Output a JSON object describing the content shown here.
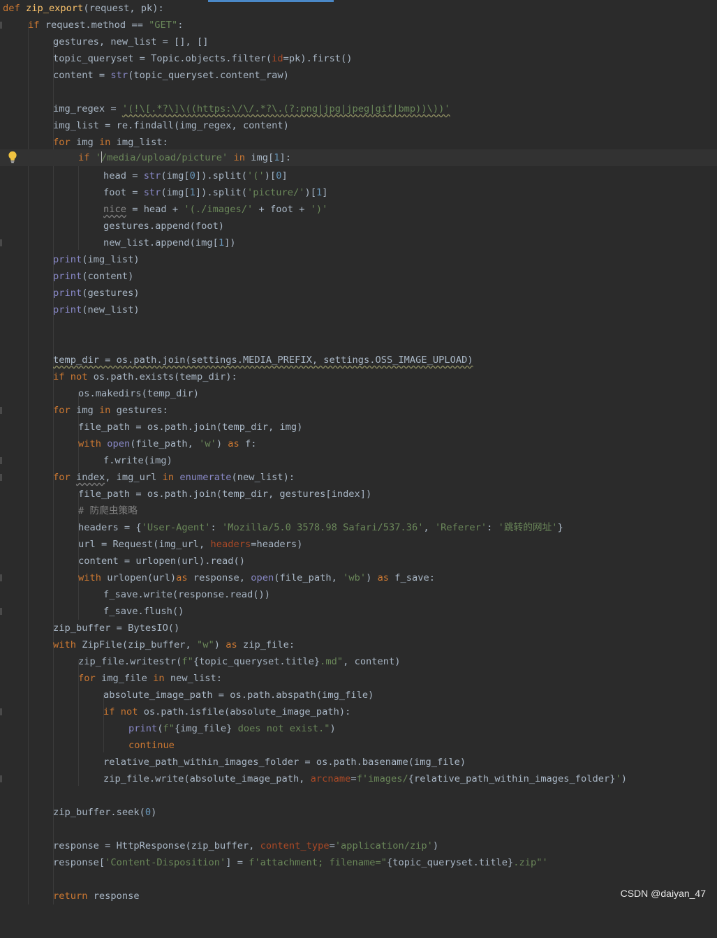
{
  "editor": {
    "lines": {
      "l1_def": "def",
      "l1_name": "zip_export",
      "l1_rest": "(request, pk):",
      "l2_if": "if",
      "l2_mid": " request.method == ",
      "l2_str": "\"GET\"",
      "l2_end": ":",
      "l3": "gestures, new_list = [], []",
      "l4_a": "topic_queryset = Topic.objects.filter(",
      "l4_param": "id",
      "l4_b": "=pk).first()",
      "l5_a": "content = ",
      "l5_bi": "str",
      "l5_b": "(topic_queryset.content_raw)",
      "l7_a": "img_regex = ",
      "l7_str": "'(!\\[.*?\\]\\((https:\\/\\/.*?\\.(?:png|jpg|jpeg|gif|bmp))\\))'",
      "l8": "img_list = re.findall(img_regex, content)",
      "l9_for": "for",
      "l9_a": " img ",
      "l9_in": "in",
      "l9_b": " img_list:",
      "l10_if": "if",
      "l10_q": " '",
      "l10_str": "/media/upload/picture'",
      "l10_in": "in",
      "l10_a": " img[",
      "l10_num": "1",
      "l10_b": "]:",
      "l11_a": "head = ",
      "l11_bi": "str",
      "l11_b": "(img[",
      "l11_n0": "0",
      "l11_c": "]).split(",
      "l11_s": "'('",
      "l11_d": ")[",
      "l11_n1": "0",
      "l11_e": "]",
      "l12_a": "foot = ",
      "l12_bi": "str",
      "l12_b": "(img[",
      "l12_n0": "1",
      "l12_c": "]).split(",
      "l12_s": "'picture/'",
      "l12_d": ")[",
      "l12_n1": "1",
      "l12_e": "]",
      "l13_var": "nice",
      "l13_a": " = head + ",
      "l13_s1": "'(./images/'",
      "l13_b": " + foot + ",
      "l13_s2": "')'",
      "l14": "gestures.append(foot)",
      "l15_a": "new_list.append(img[",
      "l15_n": "1",
      "l15_b": "])",
      "l16_bi": "print",
      "l16_a": "(img_list)",
      "l17_bi": "print",
      "l17_a": "(content)",
      "l18_bi": "print",
      "l18_a": "(gestures)",
      "l19_bi": "print",
      "l19_a": "(new_list)",
      "l22": "temp_dir = os.path.join(settings.MEDIA_PREFIX, settings.OSS_IMAGE_UPLOAD)",
      "l23_if": "if not",
      "l23_a": " os.path.exists(temp_dir):",
      "l24": "os.makedirs(temp_dir)",
      "l25_for": "for",
      "l25_a": " img ",
      "l25_in": "in",
      "l25_b": " gestures:",
      "l26": "file_path = os.path.join(temp_dir, img)",
      "l27_with": "with",
      "l27_bi": "open",
      "l27_a": "(file_path, ",
      "l27_s": "'w'",
      "l27_b": ") ",
      "l27_as": "as",
      "l27_c": " f:",
      "l28": "f.write(img)",
      "l29_for": "for",
      "l29_var": "index",
      "l29_a": ", img_url ",
      "l29_in": "in",
      "l29_bi": "enumerate",
      "l29_b": "(new_list):",
      "l30": "file_path = os.path.join(temp_dir, gestures[index])",
      "l31_cmt": "# 防爬虫策略",
      "l32_a": "headers = {",
      "l32_s1": "'User-Agent'",
      "l32_b": ": ",
      "l32_s2": "'Mozilla/5.0 3578.98 Safari/537.36'",
      "l32_c": ", ",
      "l32_s3": "'Referer'",
      "l32_d": ": ",
      "l32_s4": "'跳转的网址'",
      "l32_e": "}",
      "l33_a": "url = Request(img_url, ",
      "l33_param": "headers",
      "l33_b": "=headers)",
      "l34": "content = urlopen(url).read()",
      "l35_with": "with",
      "l35_a": " urlopen(url)",
      "l35_as": "as",
      "l35_b": " response, ",
      "l35_bi": "open",
      "l35_c": "(file_path, ",
      "l35_s": "'wb'",
      "l35_d": ") ",
      "l35_as2": "as",
      "l35_e": " f_save:",
      "l36": "f_save.write(response.read())",
      "l37": "f_save.flush()",
      "l38": "zip_buffer = BytesIO()",
      "l39_with": "with",
      "l39_a": " ZipFile(zip_buffer, ",
      "l39_s": "\"w\"",
      "l39_b": ") ",
      "l39_as": "as",
      "l39_c": " zip_file:",
      "l40_a": "zip_file.writestr(",
      "l40_s1": "f\"",
      "l40_b": "{topic_queryset.title}",
      "l40_s2": ".md\"",
      "l40_c": ", content)",
      "l41_for": "for",
      "l41_a": " img_file ",
      "l41_in": "in",
      "l41_b": " new_list:",
      "l42": "absolute_image_path = os.path.abspath(img_file)",
      "l43_if": "if not",
      "l43_a": " os.path.isfile(absolute_image_path):",
      "l44_bi": "print",
      "l44_a": "(",
      "l44_s1": "f\"",
      "l44_b": "{img_file}",
      "l44_s2": " does not exist.\"",
      "l44_c": ")",
      "l45_kw": "continue",
      "l46": "relative_path_within_images_folder = os.path.basename(img_file)",
      "l47_a": "zip_file.write(absolute_image_path, ",
      "l47_param": "arcname",
      "l47_b": "=",
      "l47_s1": "f'images/",
      "l47_c": "{relative_path_within_images_folder}",
      "l47_s2": "'",
      "l47_d": ")",
      "l49_a": "zip_buffer.seek(",
      "l49_n": "0",
      "l49_b": ")",
      "l51_a": "response = HttpResponse(zip_buffer, ",
      "l51_param": "content_type",
      "l51_b": "=",
      "l51_s": "'application/zip'",
      "l51_c": ")",
      "l52_a": "response[",
      "l52_s1": "'Content-Disposition'",
      "l52_b": "] = ",
      "l52_s2": "f'attachment; filename=\"",
      "l52_c": "{topic_queryset.title}",
      "l52_s3": ".zip\"'",
      "l54_kw": "return",
      "l54_a": " response"
    },
    "colors": {
      "background": "#2b2b2b",
      "keyword": "#cc7832",
      "function": "#ffc66d",
      "string": "#6a8759",
      "number": "#6897bb",
      "builtin": "#8888c6",
      "param": "#aa4926",
      "comment": "#808080",
      "text": "#a9b7c6"
    },
    "icons": {
      "intention_bulb": "lightbulb-icon"
    }
  },
  "watermark": "CSDN @daiyan_47"
}
